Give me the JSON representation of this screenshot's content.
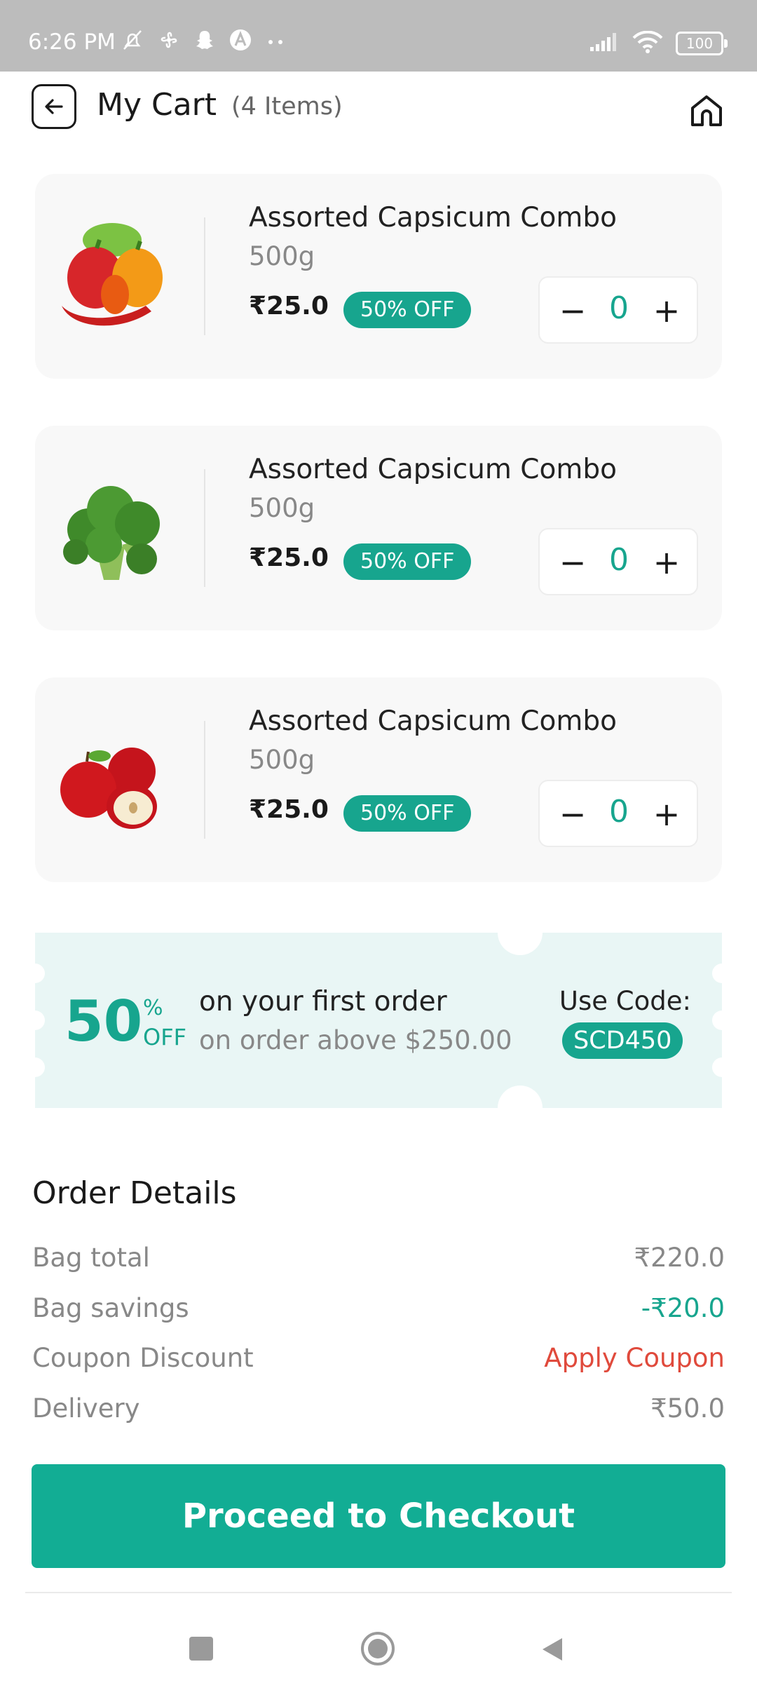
{
  "status": {
    "time": "6:26 PM",
    "battery": "100"
  },
  "header": {
    "title": "My Cart",
    "count": "(4 Items)"
  },
  "items": [
    {
      "name": "Assorted Capsicum Combo",
      "weight": "500g",
      "price": "₹25.0",
      "badge": "50% OFF",
      "qty": "0",
      "image": "capsicum-image"
    },
    {
      "name": "Assorted Capsicum Combo",
      "weight": "500g",
      "price": "₹25.0",
      "badge": "50% OFF",
      "qty": "0",
      "image": "broccoli-image"
    },
    {
      "name": "Assorted Capsicum Combo",
      "weight": "500g",
      "price": "₹25.0",
      "badge": "50% OFF",
      "qty": "0",
      "image": "apple-image"
    }
  ],
  "stepper": {
    "minus": "−",
    "plus": "+"
  },
  "coupon": {
    "amount": "50",
    "percent": "%",
    "off": "OFF",
    "line1": "on your first order",
    "line2": "on order above $250.00",
    "code_label": "Use Code:",
    "code": "SCD450"
  },
  "order_details": {
    "title": "Order Details",
    "rows": [
      {
        "label": "Bag total",
        "value": "₹220.0"
      },
      {
        "label": "Bag savings",
        "value": "-₹20.0"
      },
      {
        "label": "Coupon Discount",
        "value": "Apply Coupon"
      },
      {
        "label": "Delivery",
        "value": "₹50.0"
      }
    ]
  },
  "checkout": {
    "label": "Proceed to Checkout"
  },
  "colors": {
    "accent": "#17a58e",
    "button": "#12ad94",
    "apply_coupon": "#e04a3c",
    "coupon_bg": "#e9f6f5"
  }
}
